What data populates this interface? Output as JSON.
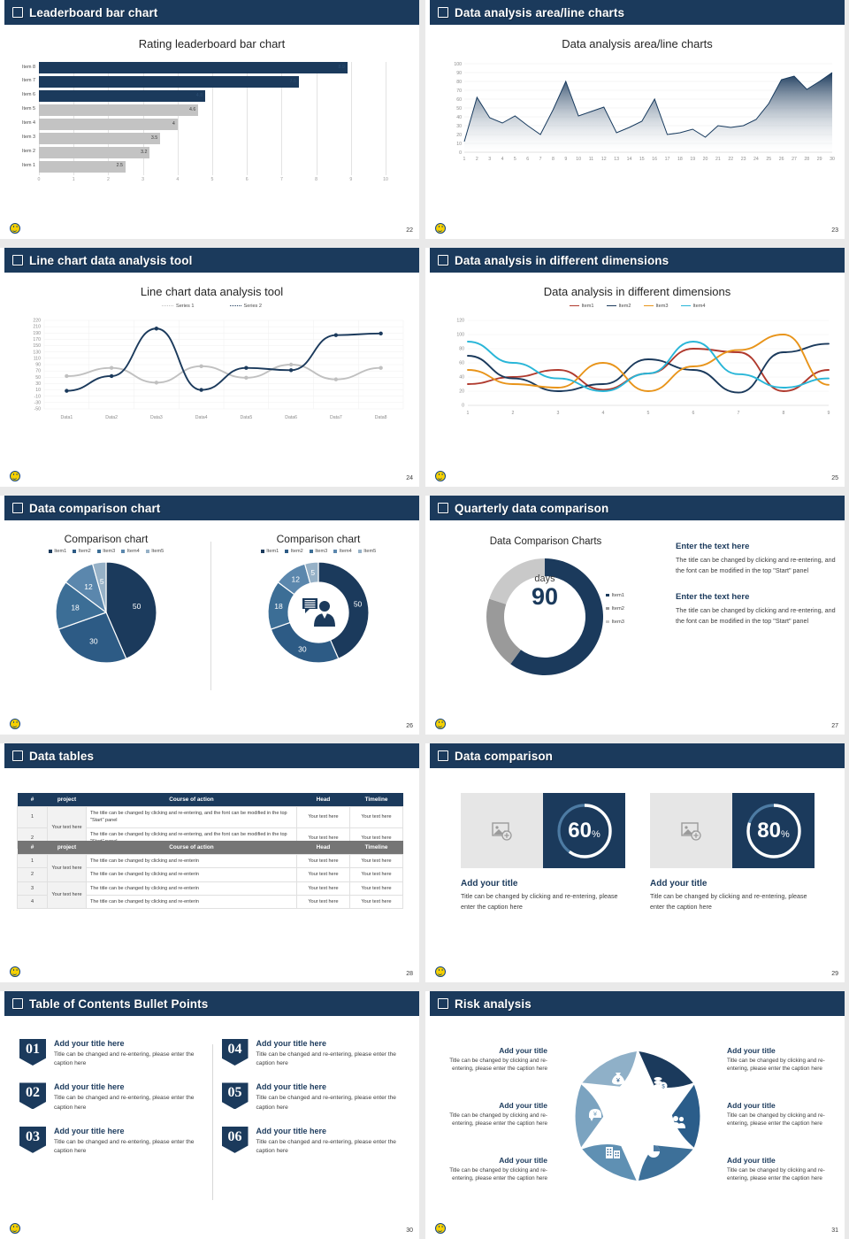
{
  "theme": {
    "navy": "#1b3a5c",
    "navy_mid": "#2d5b85",
    "steel": "#4d7ba3",
    "gray_dark": "#757575",
    "gray": "#c3c3c3",
    "gray_light": "#d9d9d9",
    "accent_red": "#b03a2e",
    "accent_orange": "#e8941a",
    "accent_cyan": "#29b6d8",
    "bg": "#e9e9e9"
  },
  "slides": [
    {
      "page": "22",
      "header": "Leaderboard bar chart",
      "chart_title": "Rating leaderboard bar chart",
      "chart_data": {
        "type": "bar",
        "orientation": "horizontal",
        "title": "Rating leaderboard bar chart",
        "categories": [
          "Item 1",
          "Item 2",
          "Item 3",
          "Item 4",
          "Item 5",
          "Item 6",
          "Item 7",
          "Item 8"
        ],
        "values": [
          2.5,
          3.2,
          3.5,
          4,
          4.6,
          4.8,
          7.5,
          8.9
        ],
        "value_labels": [
          "2.5",
          "3.2",
          "3.5",
          "4",
          "4.6",
          "4.8",
          "7.5",
          "8.9"
        ],
        "highlighted": [
          "Item 6",
          "Item 7",
          "Item 8"
        ],
        "xlabel": "",
        "ylabel": "",
        "xlim": [
          0,
          10
        ],
        "xticks": [
          "0",
          "1",
          "2",
          "3",
          "4",
          "5",
          "6",
          "7",
          "8",
          "9",
          "10"
        ],
        "grid": true,
        "legend": "none"
      }
    },
    {
      "page": "23",
      "header": "Data analysis area/line charts",
      "chart_title": "Data analysis area/line charts",
      "chart_data": {
        "type": "area",
        "title": "Data analysis area/line charts",
        "x": [
          1,
          2,
          3,
          4,
          5,
          6,
          7,
          8,
          9,
          10,
          11,
          12,
          13,
          14,
          15,
          16,
          17,
          18,
          19,
          20,
          21,
          22,
          23,
          24,
          25,
          26,
          27,
          28,
          29,
          30
        ],
        "values": [
          12,
          62,
          39,
          33,
          41,
          30,
          20,
          48,
          80,
          41,
          46,
          51,
          22,
          28,
          35,
          60,
          20,
          22,
          26,
          17,
          30,
          28,
          30,
          37,
          55,
          82,
          86,
          71,
          80,
          90
        ],
        "xlabel": "",
        "ylabel": "",
        "ylim": [
          0,
          100
        ],
        "yticks": [
          "0",
          "10",
          "20",
          "30",
          "40",
          "50",
          "60",
          "70",
          "80",
          "90",
          "100"
        ],
        "xticks": [
          "1",
          "2",
          "3",
          "4",
          "5",
          "6",
          "7",
          "8",
          "9",
          "10",
          "11",
          "12",
          "13",
          "14",
          "15",
          "16",
          "17",
          "18",
          "19",
          "20",
          "21",
          "22",
          "23",
          "24",
          "25",
          "26",
          "27",
          "28",
          "29",
          "30"
        ],
        "grid": true,
        "legend": "none"
      }
    },
    {
      "page": "24",
      "header": "Line chart data analysis tool",
      "chart_title": "Line chart data analysis tool",
      "chart_data": {
        "type": "line",
        "title": "Line chart data analysis tool",
        "categories": [
          "Data1",
          "Data2",
          "Data3",
          "Data4",
          "Data5",
          "Data6",
          "Data7",
          "Data8"
        ],
        "series": [
          {
            "name": "Series 1",
            "values": [
              50,
              75,
              30,
              80,
              45,
              85,
              40,
              75
            ],
            "color": "#c0c0c0"
          },
          {
            "name": "Series 2",
            "values": [
              5,
              50,
              195,
              8,
              75,
              68,
              175,
              180
            ],
            "color": "#1b3a5c"
          }
        ],
        "ylim": [
          -50,
          220
        ],
        "yticks": [
          "220",
          "210",
          "190",
          "170",
          "150",
          "130",
          "110",
          "90",
          "70",
          "50",
          "30",
          "10",
          "-10",
          "-30",
          "-50"
        ],
        "xlabel": "",
        "ylabel": "",
        "grid": true,
        "legend": "top"
      }
    },
    {
      "page": "25",
      "header": "Data analysis in different dimensions",
      "chart_title": "Data analysis in different dimensions",
      "chart_data": {
        "type": "line",
        "title": "Data analysis in different dimensions",
        "x": [
          1,
          2,
          3,
          4,
          5,
          6,
          7,
          8,
          9
        ],
        "series": [
          {
            "name": "Item1",
            "values": [
              30,
              40,
              50,
              22,
              45,
              80,
              75,
              20,
              50
            ],
            "color": "#b03a2e"
          },
          {
            "name": "Item2",
            "values": [
              70,
              38,
              20,
              30,
              65,
              50,
              18,
              75,
              87
            ],
            "color": "#1b3a5c"
          },
          {
            "name": "Item3",
            "values": [
              50,
              30,
              25,
              60,
              20,
              55,
              78,
              100,
              29
            ],
            "color": "#e8941a"
          },
          {
            "name": "Item4",
            "values": [
              90,
              60,
              38,
              20,
              45,
              90,
              44,
              25,
              38
            ],
            "color": "#29b6d8"
          }
        ],
        "ylim": [
          0,
          120
        ],
        "yticks": [
          "0",
          "20",
          "40",
          "60",
          "80",
          "100",
          "120"
        ],
        "xticks": [
          "1",
          "2",
          "3",
          "4",
          "5",
          "6",
          "7",
          "8",
          "9"
        ],
        "xlabel": "",
        "ylabel": "",
        "grid": true,
        "legend": "top"
      }
    },
    {
      "page": "26",
      "header": "Data comparison chart",
      "left_title": "Comparison chart",
      "right_title": "Comparison chart",
      "legend": [
        "Item1",
        "Item2",
        "Item3",
        "Item4",
        "Item5"
      ],
      "chart_data": [
        {
          "type": "pie",
          "title": "Comparison chart",
          "labels": [
            "Item1",
            "Item2",
            "Item3",
            "Item4",
            "Item5"
          ],
          "values": [
            50,
            30,
            18,
            12,
            5
          ],
          "colors": [
            "#1b3a5c",
            "#2d5b85",
            "#3c6e96",
            "#5b87ad",
            "#96b1c7"
          ],
          "legend": "top"
        },
        {
          "type": "pie",
          "variant": "donut",
          "title": "Comparison chart",
          "labels": [
            "Item1",
            "Item2",
            "Item3",
            "Item4",
            "Item5"
          ],
          "values": [
            50,
            30,
            18,
            12,
            5
          ],
          "colors": [
            "#1b3a5c",
            "#2d5b85",
            "#3c6e96",
            "#5b87ad",
            "#96b1c7"
          ],
          "center_icon": "presenter-icon",
          "legend": "top"
        }
      ]
    },
    {
      "page": "27",
      "header": "Quarterly data comparison",
      "chart_title": "Data Comparison Charts",
      "center_unit": "days",
      "center_value": "90",
      "chart_data": {
        "type": "pie",
        "variant": "donut",
        "title": "Data Comparison Charts",
        "labels": [
          "Item1",
          "Item2",
          "Item3"
        ],
        "values": [
          60,
          20,
          20
        ],
        "colors": [
          "#1b3a5c",
          "#9a9a9a",
          "#c9c9c9"
        ],
        "center_label": "days",
        "center_value": "90",
        "legend": "right"
      },
      "blocks": [
        {
          "title": "Enter the text here",
          "body": "The title can be changed by clicking and re-entering, and the font can be modified in the top \"Start\" panel"
        },
        {
          "title": "Enter the text here",
          "body": "The title can be changed by clicking and re-entering, and the font can be modified in the top \"Start\" panel"
        }
      ]
    },
    {
      "page": "28",
      "header": "Data tables",
      "table_top": {
        "columns": [
          "#",
          "project",
          "Course of action",
          "Head",
          "Timeline"
        ],
        "rows": [
          {
            "n": "1",
            "project": "Your text here",
            "course": "The title can be changed by clicking and re-entering, and the font can be modified in the top \"Start\" panel",
            "head": "Your text here",
            "timeline": "Your text here"
          },
          {
            "n": "2",
            "project": "",
            "course": "The title can be changed by clicking and re-entering, and the font can be modified in the top \"Start\" panel",
            "head": "Your text here",
            "timeline": "Your text here"
          }
        ]
      },
      "table_bottom": {
        "columns": [
          "#",
          "project",
          "Course of action",
          "Head",
          "Timeline"
        ],
        "rows": [
          {
            "n": "1",
            "project": "Your text here",
            "course": "The title can be changed by clicking and re-enterin",
            "head": "Your text here",
            "timeline": "Your text here"
          },
          {
            "n": "2",
            "project": "",
            "course": "The title can be changed by clicking and re-enterin",
            "head": "Your text here",
            "timeline": "Your text here"
          },
          {
            "n": "3",
            "project": "Your text here",
            "course": "The title can be changed by clicking and re-enterin",
            "head": "Your text here",
            "timeline": "Your text here"
          },
          {
            "n": "4",
            "project": "",
            "course": "The title can be changed by clicking and re-enterin",
            "head": "Your text here",
            "timeline": "Your text here"
          }
        ]
      }
    },
    {
      "page": "29",
      "header": "Data comparison",
      "cards": [
        {
          "percent": "60",
          "unit": "%",
          "title": "Add your title",
          "body": "Title can be changed by clicking and re-entering, please enter the caption here"
        },
        {
          "percent": "80",
          "unit": "%",
          "title": "Add your title",
          "body": "Title can be changed by clicking and re-entering, please enter the caption here"
        }
      ]
    },
    {
      "page": "30",
      "header": "Table of Contents Bullet Points",
      "items": [
        {
          "num": "01",
          "title": "Add your title here",
          "body": "Title can be changed and re-entering, please enter the caption here"
        },
        {
          "num": "04",
          "title": "Add your title here",
          "body": "Title can be changed and re-entering, please enter the caption here"
        },
        {
          "num": "02",
          "title": "Add your title here",
          "body": "Title can be changed and re-entering, please enter the caption here"
        },
        {
          "num": "05",
          "title": "Add your title here",
          "body": "Title can be changed and re-entering, please enter the caption here"
        },
        {
          "num": "03",
          "title": "Add your title here",
          "body": "Title can be changed and re-entering, please enter the caption here"
        },
        {
          "num": "06",
          "title": "Add your title here",
          "body": "Title can be changed and re-entering, please enter the caption here"
        }
      ]
    },
    {
      "page": "31",
      "header": "Risk analysis",
      "left_items": [
        {
          "title": "Add your title",
          "body": "Title can be changed by clicking and re-entering, please enter the caption here"
        },
        {
          "title": "Add your title",
          "body": "Title can be changed by clicking and re-entering, please enter the caption here"
        },
        {
          "title": "Add your title",
          "body": "Title can be changed by clicking and re-entering, please enter the caption here"
        }
      ],
      "right_items": [
        {
          "title": "Add your title",
          "body": "Title can be changed by clicking and re-entering, please enter the caption here"
        },
        {
          "title": "Add your title",
          "body": "Title can be changed by clicking and re-entering, please enter the caption here"
        },
        {
          "title": "Add your title",
          "body": "Title can be changed by clicking and re-entering, please enter the caption here"
        }
      ],
      "pinwheel_icons": [
        "money-bag-icon",
        "coins-icon",
        "people-icon",
        "pie-chart-icon",
        "building-icon",
        "savings-icon"
      ]
    }
  ]
}
